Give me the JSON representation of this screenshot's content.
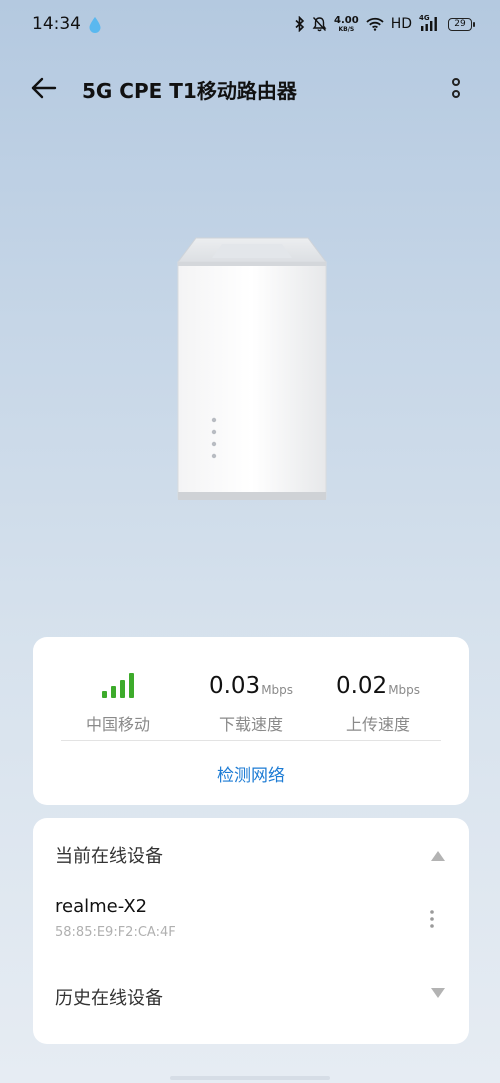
{
  "status_bar": {
    "time": "14:34",
    "net_speed_value": "4.00",
    "net_speed_unit": "KB/S",
    "hd_label": "HD",
    "network_type": "4G",
    "battery_level": "29"
  },
  "header": {
    "title": "5G CPE T1移动路由器"
  },
  "stats": {
    "carrier_label": "中国移动",
    "signal_bars": 4,
    "download_value": "0.03",
    "download_unit": "Mbps",
    "download_label": "下载速度",
    "upload_value": "0.02",
    "upload_unit": "Mbps",
    "upload_label": "上传速度",
    "check_network_label": "检测网络"
  },
  "devices": {
    "current_title": "当前在线设备",
    "items": [
      {
        "name": "realme-X2",
        "mac": "58:85:E9:F2:CA:4F"
      }
    ],
    "history_title": "历史在线设备"
  },
  "colors": {
    "accent": "#1c7bd4",
    "signal": "#3dab2b"
  }
}
